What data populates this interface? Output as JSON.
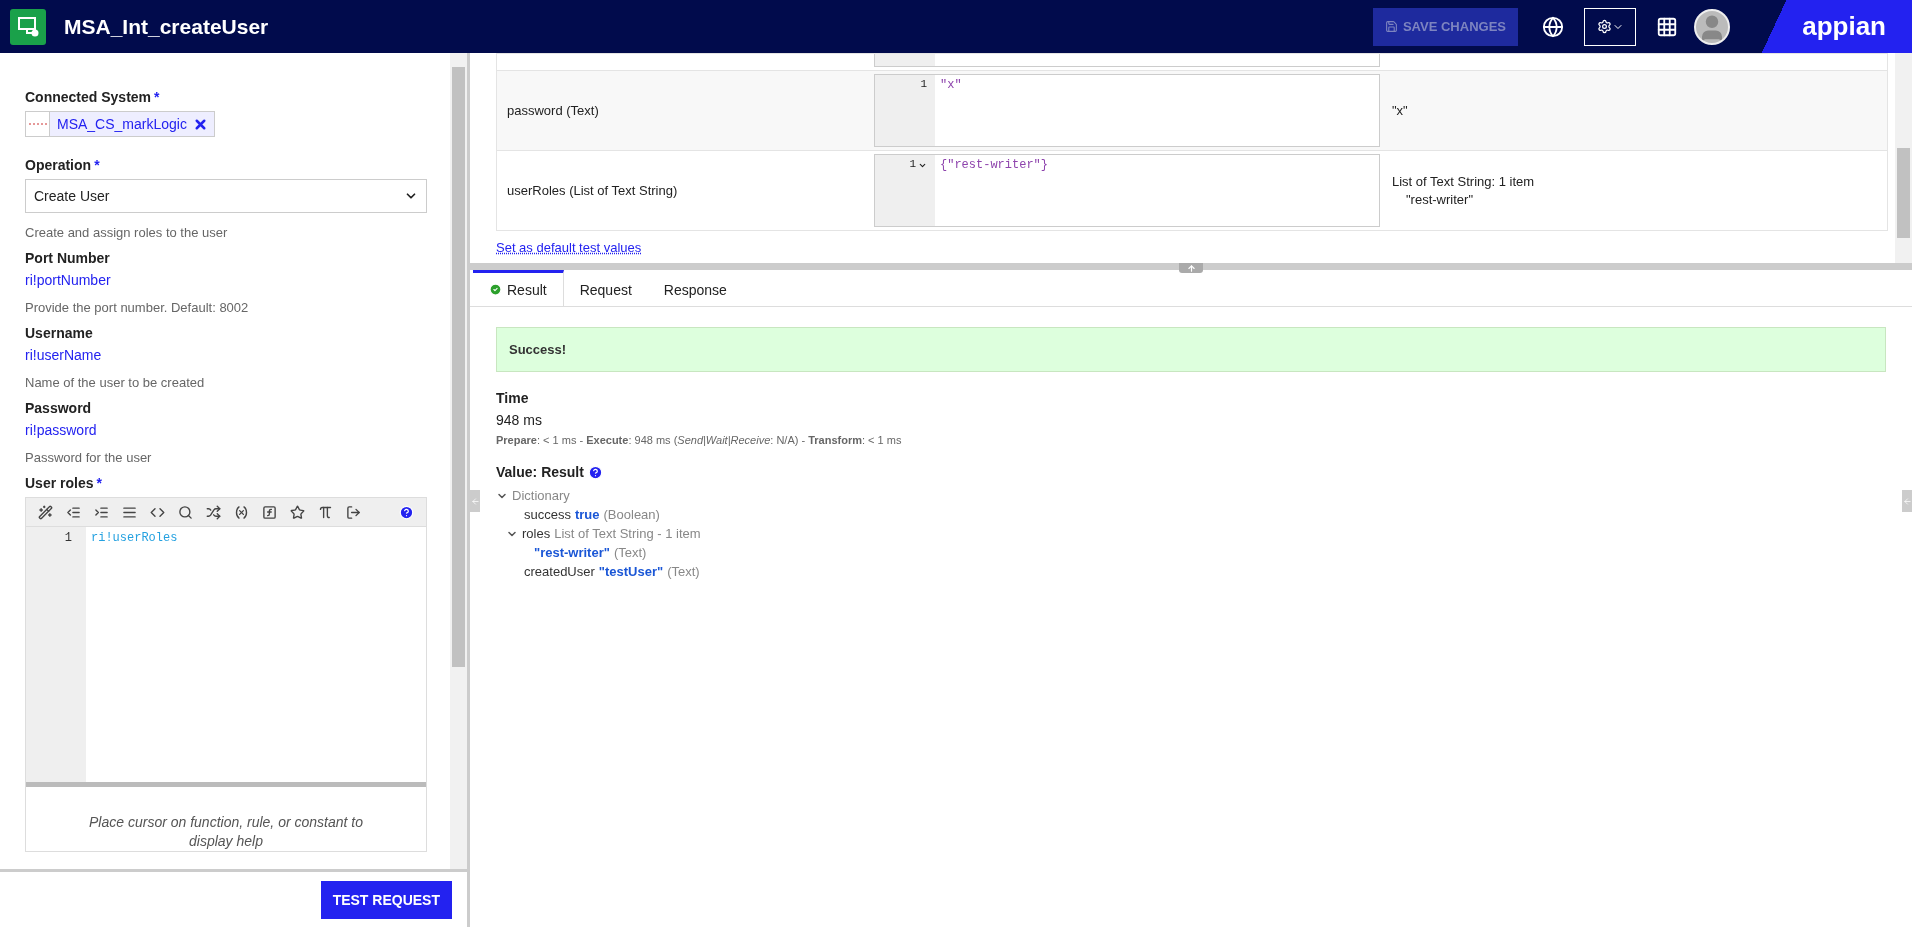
{
  "header": {
    "title": "MSA_Int_createUser",
    "save_button": {
      "label": "SAVE CHANGES",
      "disabled": true
    },
    "brand": "appian"
  },
  "left_panel": {
    "connected_system": {
      "label": "Connected System",
      "required_mark": "*",
      "value": "MSA_CS_markLogic"
    },
    "operation": {
      "label": "Operation",
      "required_mark": "*",
      "value": "Create User",
      "help": "Create and assign roles to the user"
    },
    "fields": [
      {
        "label": "Port Number",
        "value": "ri!portNumber",
        "help": "Provide the port number. Default: 8002"
      },
      {
        "label": "Username",
        "value": "ri!userName",
        "help": "Name of the user to be created"
      },
      {
        "label": "Password",
        "value": "ri!password",
        "help": "Password for the user"
      }
    ],
    "user_roles": {
      "label": "User roles",
      "required_mark": "*",
      "lines": [
        {
          "number": "1",
          "code": "ri!userRoles"
        }
      ],
      "help_text": "Place cursor on function, rule, or constant to display help"
    },
    "test_button": "TEST REQUEST"
  },
  "test_inputs": {
    "rows": [
      {
        "name": "password (Text)",
        "line": "1",
        "code": "\"x\"",
        "foldable": false,
        "result": [
          "\"x\""
        ]
      },
      {
        "name": "userRoles (List of Text String)",
        "line": "1",
        "code": "{\"rest-writer\"}",
        "foldable": true,
        "result": [
          "List of Text String: 1 item",
          "\"rest-writer\""
        ]
      }
    ],
    "default_link": "Set as default test values"
  },
  "result_tabs": [
    {
      "label": "Result",
      "selected": true,
      "kind": "success"
    },
    {
      "label": "Request",
      "selected": false,
      "kind": "plain"
    },
    {
      "label": "Response",
      "selected": false,
      "kind": "plain"
    }
  ],
  "result": {
    "status": "Success!",
    "time_label": "Time",
    "time": "948 ms",
    "breakdown": "**Prepare**: < 1 ms - **Execute**: 948 ms (*Send|Wait|Receive*: N/A) - **Transform**: < 1 ms",
    "value_label": "Value: Result",
    "tree": [
      {
        "type": "Dictionary",
        "expanded": true,
        "children": [
          {
            "key": "success",
            "value": "true",
            "type": "(Boolean)"
          },
          {
            "key": "roles",
            "type": "List of Text String - 1 item",
            "expanded": true,
            "children": [
              {
                "value": "\"rest-writer\"",
                "type": "(Text)"
              }
            ]
          },
          {
            "key": "createdUser",
            "value": "\"testUser\"",
            "type": "(Text)"
          }
        ]
      }
    ]
  }
}
